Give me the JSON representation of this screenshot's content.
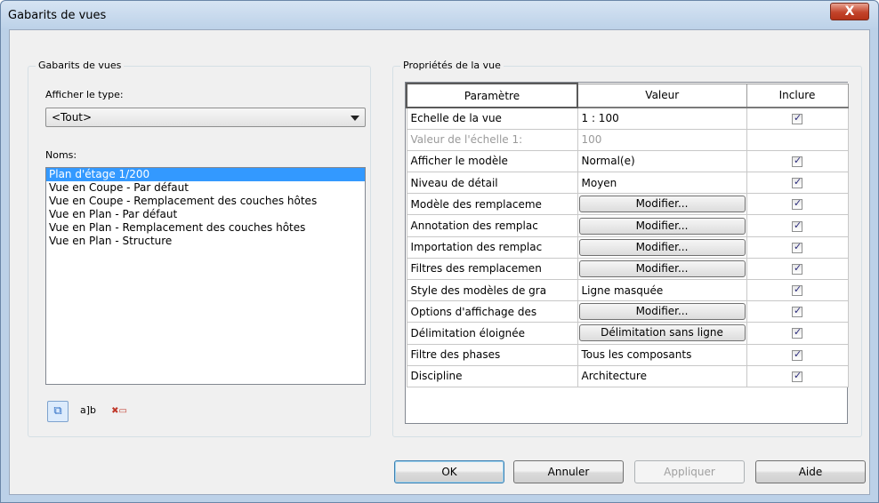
{
  "window": {
    "title": "Gabarits de vues",
    "close_label": "X"
  },
  "left_panel": {
    "group_label": "Gabarits de vues",
    "type_label": "Afficher le type:",
    "type_value": "<Tout>",
    "names_label": "Noms:",
    "names": [
      "Plan d'étage 1/200",
      "Vue en Coupe - Par défaut",
      "Vue en Coupe - Remplacement des couches hôtes",
      "Vue en Plan - Par défaut",
      "Vue en Plan - Remplacement des couches hôtes",
      "Vue en Plan - Structure"
    ],
    "selected_name": "Plan d'étage 1/200",
    "tools": [
      {
        "icon": "duplicate-icon",
        "glyph": "⧉"
      },
      {
        "icon": "rename-icon",
        "glyph": "a]b"
      },
      {
        "icon": "delete-icon",
        "glyph": "✖▭"
      }
    ]
  },
  "right_panel": {
    "group_label": "Propriétés de la vue",
    "columns": [
      "Paramètre",
      "Valeur",
      "Inclure"
    ],
    "rows": [
      {
        "param": "Echelle de la vue",
        "value": "1 : 100",
        "button": false,
        "include": true
      },
      {
        "param": "Valeur de l'échelle   1:",
        "value": "100",
        "button": false,
        "include": null,
        "disabled": true
      },
      {
        "param": "Afficher le modèle",
        "value": "Normal(e)",
        "button": false,
        "include": true
      },
      {
        "param": "Niveau de détail",
        "value": "Moyen",
        "button": false,
        "include": true
      },
      {
        "param": "Modèle des remplaceme",
        "value": "Modifier...",
        "button": true,
        "include": true
      },
      {
        "param": "Annotation des remplac",
        "value": "Modifier...",
        "button": true,
        "include": true
      },
      {
        "param": "Importation des remplac",
        "value": "Modifier...",
        "button": true,
        "include": true
      },
      {
        "param": "Filtres des remplacemen",
        "value": "Modifier...",
        "button": true,
        "include": true
      },
      {
        "param": "Style des modèles de gra",
        "value": "Ligne masquée",
        "button": false,
        "include": true
      },
      {
        "param": "Options d'affichage des",
        "value": "Modifier...",
        "button": true,
        "include": true
      },
      {
        "param": "Délimitation éloignée",
        "value": "Délimitation sans ligne",
        "button": true,
        "include": true
      },
      {
        "param": "Filtre des phases",
        "value": "Tous les composants",
        "button": false,
        "include": true
      },
      {
        "param": "Discipline",
        "value": "Architecture",
        "button": false,
        "include": true
      }
    ]
  },
  "footer": {
    "ok": "OK",
    "cancel": "Annuler",
    "apply": "Appliquer",
    "help": "Aide"
  }
}
